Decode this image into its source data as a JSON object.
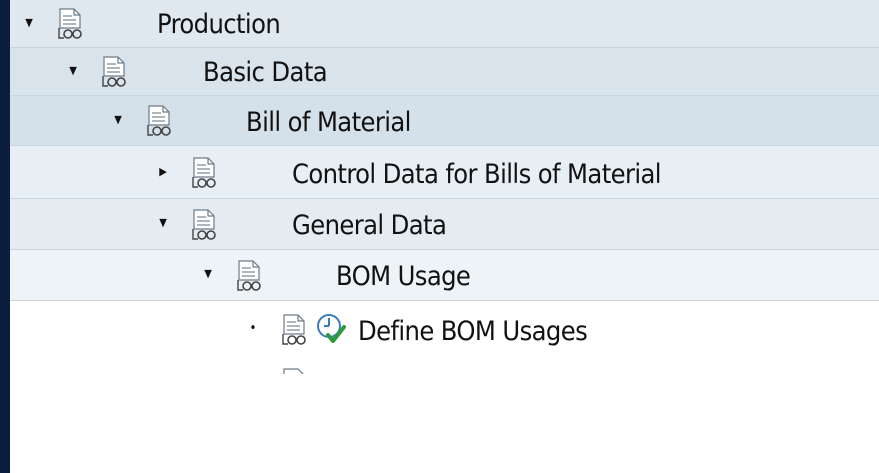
{
  "tree": {
    "nodes": [
      {
        "label": "Production",
        "expander": "expanded",
        "level": 0,
        "row_bg": "#dfe8ef"
      },
      {
        "label": "Basic Data",
        "expander": "expanded",
        "level": 1,
        "row_bg": "#d8e3eb"
      },
      {
        "label": "Bill of Material",
        "expander": "expanded",
        "level": 2,
        "row_bg": "#d5e1ea"
      },
      {
        "label": "Control Data for Bills of Material",
        "expander": "collapsed",
        "level": 3,
        "row_bg": "#e8eff4"
      },
      {
        "label": "General Data",
        "expander": "expanded",
        "level": 3,
        "row_bg": "#e4ecf2"
      },
      {
        "label": "BOM Usage",
        "expander": "expanded",
        "level": 4,
        "row_bg": "#eef3f7"
      },
      {
        "label": "Define BOM Usages",
        "expander": "leaf",
        "level": 5,
        "row_bg": "#ffffff",
        "activity_icon": "clock-check-icon"
      }
    ]
  },
  "colors": {
    "outer_background": "#0b1e3d",
    "row_separator": "#c9d6e0",
    "text": "#111111",
    "check_green": "#2e9a3e",
    "clock_blue": "#3a7bbf"
  }
}
